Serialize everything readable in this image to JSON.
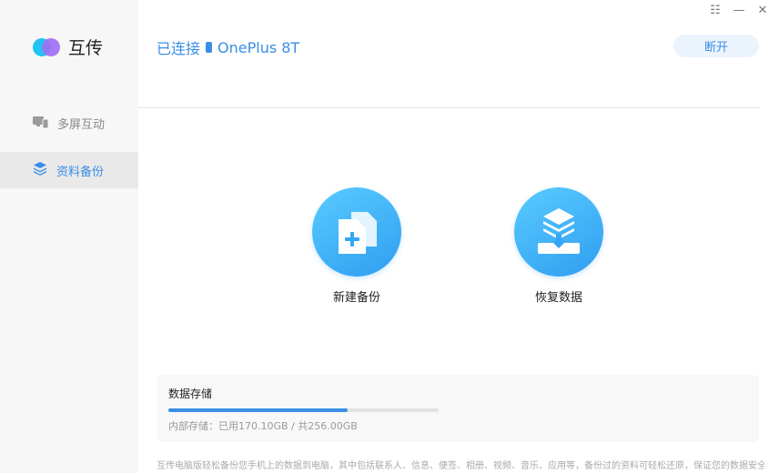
{
  "app": {
    "name": "互传"
  },
  "window": {
    "menu_icon": "☷",
    "minimize_icon": "—",
    "close_icon": "✕"
  },
  "sidebar": {
    "items": [
      {
        "label": "多屏互动",
        "icon": "devices-icon",
        "active": false
      },
      {
        "label": "资料备份",
        "icon": "layers-icon",
        "active": true
      }
    ]
  },
  "header": {
    "status_prefix": "已连接",
    "device_name": "OnePlus 8T",
    "disconnect_label": "断开"
  },
  "actions": {
    "new_backup_label": "新建备份",
    "restore_label": "恢复数据"
  },
  "storage": {
    "title": "数据存储",
    "used_fraction": 0.664,
    "info": "内部存储：已用170.10GB / 共256.00GB"
  },
  "footer": {
    "text": "互传电脑版轻松备份您手机上的数据到电脑，其中包括联系人、信息、便签、相册、视频、音乐、应用等，备份过的资料可轻松还原，保证您的数据安全。"
  },
  "colors": {
    "accent": "#3a8ee6",
    "sidebar_bg": "#f7f7f7",
    "circle_start": "#59cbff",
    "circle_end": "#2f9ef1"
  }
}
